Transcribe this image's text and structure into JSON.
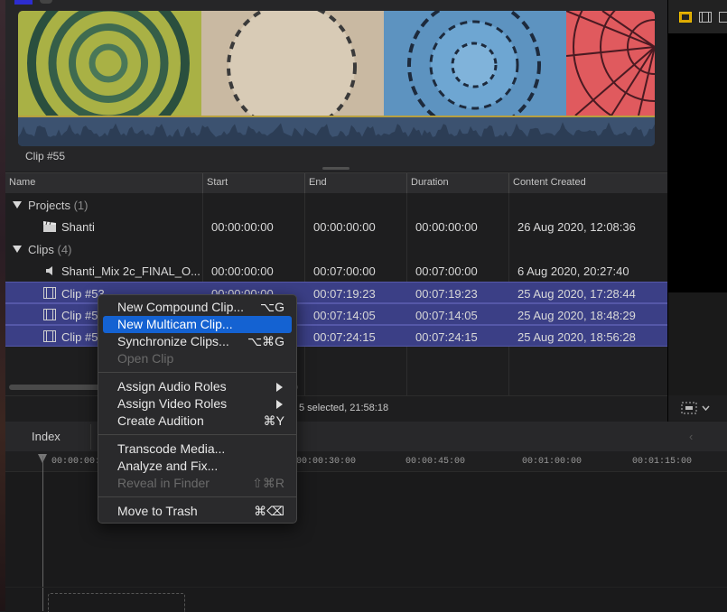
{
  "browser": {
    "clip_label": "Clip #55"
  },
  "list": {
    "columns": [
      "Name",
      "Start",
      "End",
      "Duration",
      "Content Created"
    ],
    "groups": {
      "projects": {
        "label": "Projects",
        "count": "(1)"
      },
      "clips": {
        "label": "Clips",
        "count": "(4)"
      }
    },
    "rows": [
      {
        "name": "Shanti",
        "start": "00:00:00:00",
        "end": "00:00:00:00",
        "duration": "00:00:00:00",
        "created": "26 Aug 2020, 12:08:36"
      },
      {
        "name": "Shanti_Mix 2c_FINAL_O...",
        "start": "00:00:00:00",
        "end": "00:07:00:00",
        "duration": "00:07:00:00",
        "created": "6 Aug 2020, 20:27:40"
      },
      {
        "name": "Clip #53",
        "start": "00:00:00:00",
        "end": "00:07:19:23",
        "duration": "00:07:19:23",
        "created": "25 Aug 2020, 17:28:44"
      },
      {
        "name": "Clip #5",
        "start": "",
        "end": "00:07:14:05",
        "duration": "00:07:14:05",
        "created": "25 Aug 2020, 18:48:29"
      },
      {
        "name": "Clip #5",
        "start": "",
        "end": "00:07:24:15",
        "duration": "00:07:24:15",
        "created": "25 Aug 2020, 18:56:28"
      }
    ],
    "status": "5 selected, 21:58:18"
  },
  "timeline": {
    "index_tab": "Index",
    "ticks": [
      "00:00:00:00",
      "00:00:30:00",
      "00:00:45:00",
      "00:01:00:00",
      "00:01:15:00"
    ]
  },
  "context_menu": {
    "items": [
      {
        "label": "New Compound Clip...",
        "shortcut": "⌥G"
      },
      {
        "label": "New Multicam Clip...",
        "shortcut": ""
      },
      {
        "label": "Synchronize Clips...",
        "shortcut": "⌥⌘G"
      },
      {
        "label": "Open Clip",
        "shortcut": ""
      },
      {
        "label": "Assign Audio Roles",
        "shortcut": ""
      },
      {
        "label": "Assign Video Roles",
        "shortcut": ""
      },
      {
        "label": "Create Audition",
        "shortcut": "⌘Y"
      },
      {
        "label": "Transcode Media...",
        "shortcut": ""
      },
      {
        "label": "Analyze and Fix...",
        "shortcut": ""
      },
      {
        "label": "Reveal in Finder",
        "shortcut": "⇧⌘R"
      },
      {
        "label": "Move to Trash",
        "shortcut": "⌘⌫"
      }
    ]
  },
  "colors": {
    "selection": "#3b3f86",
    "menu_highlight": "#1462d2",
    "waveform": "#3c5270"
  },
  "icons": {
    "project": "clapper-icon",
    "audio": "speaker-icon",
    "video": "filmstrip-icon"
  }
}
